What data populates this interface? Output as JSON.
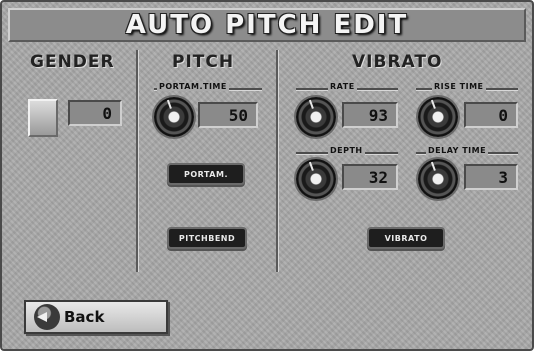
{
  "title": "AUTO PITCH EDIT",
  "sections": {
    "gender": "GENDER",
    "pitch": "PITCH",
    "vibrato": "VIBRATO"
  },
  "gender": {
    "value": "0"
  },
  "pitch": {
    "portam_time_label": "PORTAM.TIME",
    "portam_time_value": "50",
    "portam_button": "PORTAM.",
    "pitchbend_button": "PITCHBEND"
  },
  "vibrato": {
    "rate_label": "RATE",
    "rate_value": "93",
    "rise_time_label": "RISE TIME",
    "rise_time_value": "0",
    "depth_label": "DEPTH",
    "depth_value": "32",
    "delay_time_label": "DELAY TIME",
    "delay_time_value": "3",
    "vibrato_button": "VIBRATO"
  },
  "footer": {
    "back_label": "Back"
  }
}
